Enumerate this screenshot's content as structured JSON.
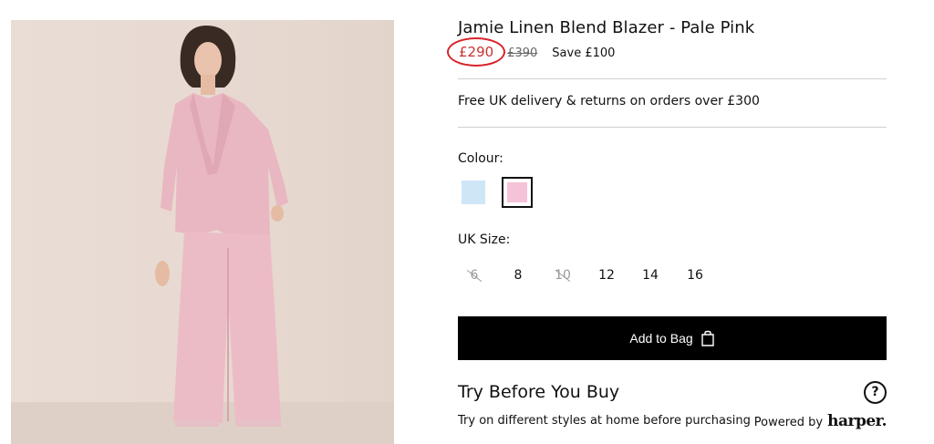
{
  "product": {
    "title": "Jamie Linen Blend Blazer - Pale Pink",
    "price_now": "£290",
    "price_was": "£390",
    "save": "Save £100",
    "delivery": "Free UK delivery & returns on orders over £300"
  },
  "colour": {
    "label": "Colour:",
    "options": [
      {
        "name": "pale-blue",
        "hex": "#cfe6f7",
        "selected": false
      },
      {
        "name": "pale-pink",
        "hex": "#f6c2d7",
        "selected": true
      }
    ]
  },
  "size": {
    "label": "UK Size:",
    "options": [
      {
        "value": "6",
        "available": false
      },
      {
        "value": "8",
        "available": true
      },
      {
        "value": "10",
        "available": false
      },
      {
        "value": "12",
        "available": true
      },
      {
        "value": "14",
        "available": true
      },
      {
        "value": "16",
        "available": true
      }
    ]
  },
  "cta": {
    "add_to_bag": "Add to Bag"
  },
  "try_before_you_buy": {
    "title": "Try Before You Buy",
    "help_icon": "?",
    "subtitle": "Try on different styles at home before purchasing",
    "powered_by": "Powered by",
    "brand": "harper."
  },
  "colors": {
    "accent_red": "#c8322f",
    "annotation_circle": "#d8242a",
    "button_bg": "#000000"
  }
}
